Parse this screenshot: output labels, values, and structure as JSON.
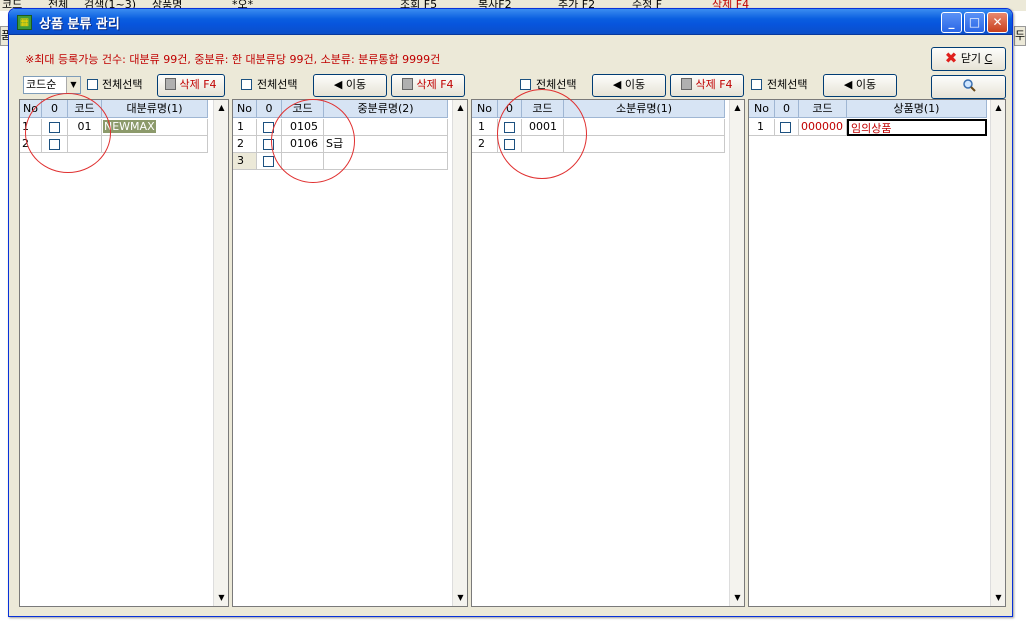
{
  "background_app": {
    "strip_items": [
      "코드",
      "전체",
      "검색(1~3)",
      "상품명",
      "*오*",
      "조회 F5",
      "복사F2",
      "추가 F2",
      "수정 F",
      "삭제 F4"
    ],
    "left_tab": "품",
    "right_tab": "두"
  },
  "window": {
    "title": "상품 분류 관리",
    "minimize": "_",
    "maximize": "□",
    "close": "✕"
  },
  "notice": "※최대 등록가능 건수: 대분류 99건, 중분류: 한 대분류당 99건, 소분류: 분류통합 9999건",
  "toolbar": {
    "sort_select_value": "코드순",
    "select_all_label": "전체선택",
    "delete_label": "삭제 F4",
    "move_label": "◀ 이동",
    "close_label": "닫기",
    "close_shortcut": "C",
    "search_icon": "magnifier-icon"
  },
  "grids": {
    "major": {
      "columns": [
        "No",
        "0",
        "코드",
        "대분류명(1)"
      ],
      "rows": [
        {
          "no": "1",
          "code": "01",
          "name": "NEWMAX"
        },
        {
          "no": "2",
          "code": "",
          "name": ""
        }
      ]
    },
    "middle": {
      "columns": [
        "No",
        "0",
        "코드",
        "중분류명(2)"
      ],
      "rows": [
        {
          "no": "1",
          "code": "0105",
          "name": ""
        },
        {
          "no": "2",
          "code": "0106",
          "name": "S급"
        },
        {
          "no": "3",
          "code": "",
          "name": ""
        }
      ]
    },
    "minor": {
      "columns": [
        "No",
        "0",
        "코드",
        "소분류명(1)"
      ],
      "rows": [
        {
          "no": "1",
          "code": "0001",
          "name": ""
        },
        {
          "no": "2",
          "code": "",
          "name": ""
        }
      ]
    },
    "product": {
      "columns": [
        "No",
        "0",
        "코드",
        "상품명(1)"
      ],
      "rows": [
        {
          "no": "1",
          "code": "000000",
          "name": "임의상품"
        }
      ]
    }
  },
  "colors": {
    "title_bar": "#0a5ee0",
    "notice_text": "#c00000",
    "annotation_circle": "#e03030",
    "selected_cell": "#8c9a6b"
  }
}
